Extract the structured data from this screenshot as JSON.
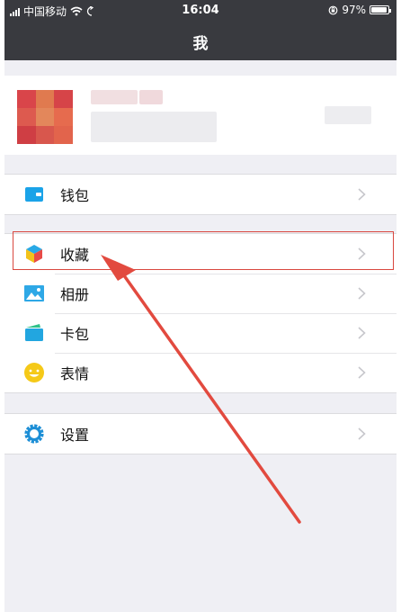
{
  "status_bar": {
    "carrier": "中国移动",
    "time": "16:04",
    "battery": "97%",
    "battery_level": 0.97
  },
  "nav": {
    "title": "我"
  },
  "menu": {
    "wallet": {
      "label": "钱包",
      "icon": "wallet-icon"
    },
    "favorites": {
      "label": "收藏",
      "icon": "cube-icon"
    },
    "album": {
      "label": "相册",
      "icon": "picture-icon"
    },
    "cards": {
      "label": "卡包",
      "icon": "card-icon"
    },
    "stickers": {
      "label": "表情",
      "icon": "smiley-icon"
    },
    "settings": {
      "label": "设置",
      "icon": "gear-icon"
    }
  },
  "colors": {
    "nav_bg": "#393a3f",
    "background": "#efeff4",
    "accent_blue": "#1aa3e8",
    "annotation_red": "#e24a3f"
  }
}
